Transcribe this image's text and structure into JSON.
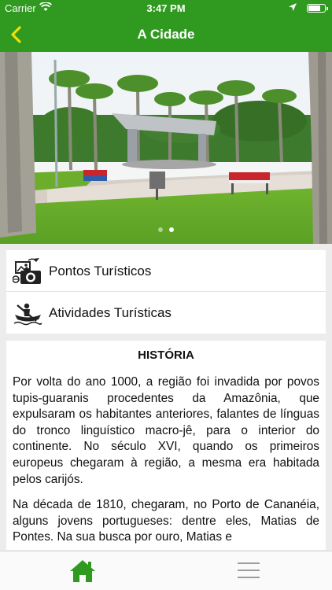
{
  "status_bar": {
    "carrier": "Carrier",
    "time": "3:47 PM",
    "battery_level": 0.8
  },
  "nav": {
    "title": "A Cidade",
    "back_icon": "chevron-left-icon"
  },
  "carousel": {
    "slide_count": 2,
    "active_index": 1
  },
  "menu": {
    "items": [
      {
        "label": "Pontos Turísticos",
        "icon": "tourist-spots-icon"
      },
      {
        "label": "Atividades Turísticas",
        "icon": "canoe-icon"
      }
    ]
  },
  "history": {
    "title": "HISTÓRIA",
    "paragraphs": [
      "Por volta do ano 1000, a região foi invadida por povos tupis-guaranis procedentes da Amazônia, que expulsaram os habitantes anteriores, falantes de línguas do tronco linguístico macro-jê, para o interior do continente. No século XVI, quando os primeiros europeus chegaram à região, a mesma era habitada pelos carijós.",
      "Na década de 1810, chegaram, no Porto de Cananéia, alguns jovens portugueses: dentre eles, Matias de Pontes. Na sua busca por ouro, Matias e"
    ]
  },
  "tabbar": {
    "home_icon": "home-icon",
    "menu_icon": "hamburger-menu-icon"
  },
  "colors": {
    "brand": "#2f9a1f",
    "background": "#ececec"
  }
}
